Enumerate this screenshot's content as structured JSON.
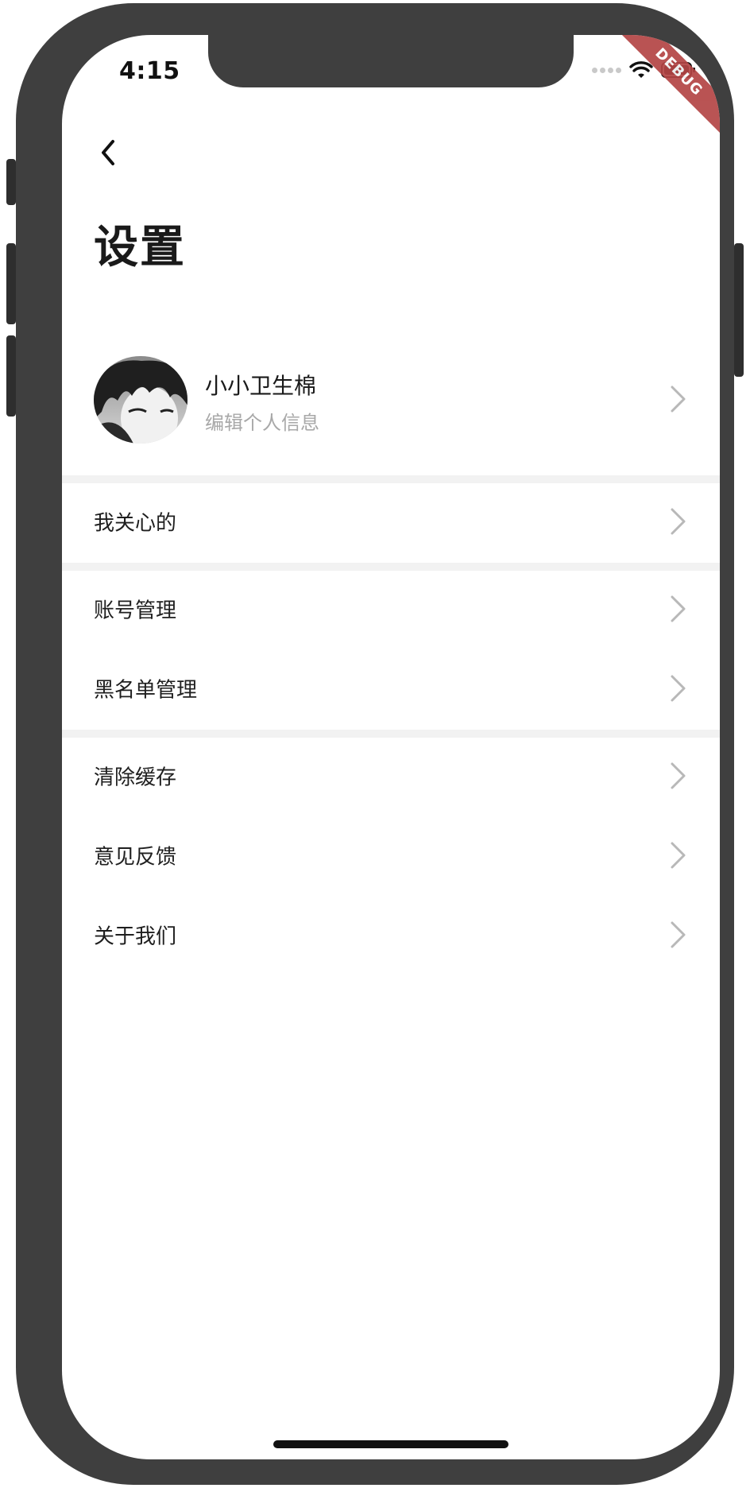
{
  "status_bar": {
    "time": "4:15"
  },
  "debug_banner": "DEBUG",
  "page": {
    "title": "设置"
  },
  "profile": {
    "name": "小小卫生棉",
    "subtitle": "编辑个人信息"
  },
  "sections": [
    {
      "items": [
        {
          "label": "我关心的"
        }
      ]
    },
    {
      "items": [
        {
          "label": "账号管理"
        },
        {
          "label": "黑名单管理"
        }
      ]
    },
    {
      "items": [
        {
          "label": "清除缓存"
        },
        {
          "label": "意见反馈"
        },
        {
          "label": "关于我们"
        }
      ]
    }
  ],
  "colors": {
    "frame": "#3f3f3f",
    "divider": "#f2f2f2",
    "chevron": "#b8b8b8",
    "debug": "#b34545"
  }
}
